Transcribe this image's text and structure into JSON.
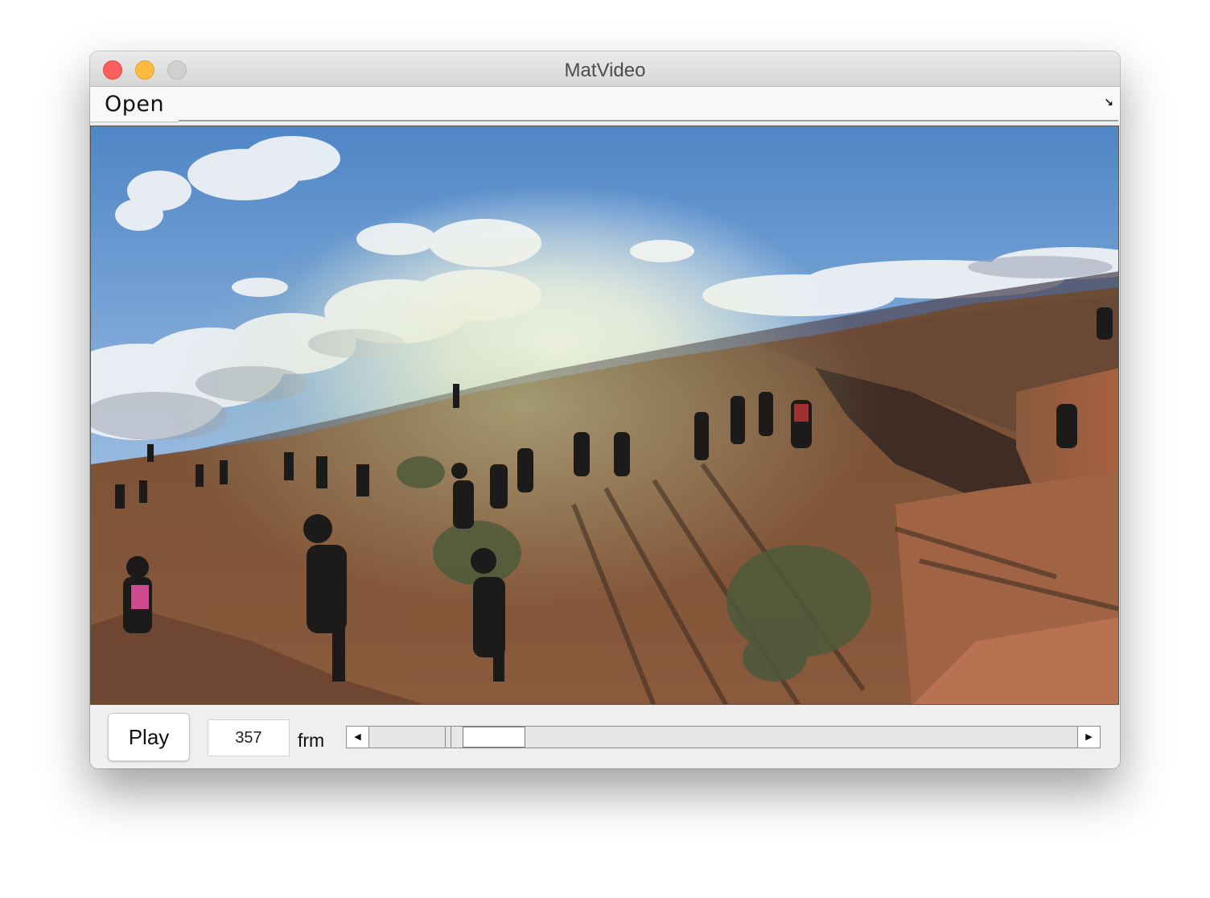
{
  "window": {
    "title": "MatVideo"
  },
  "menubar": {
    "items": [
      {
        "label": "Open"
      }
    ],
    "toolbar_toggle_icon": "expand-arrow-icon"
  },
  "video": {
    "description_icon": "video-frame"
  },
  "controls": {
    "play_label": "Play",
    "frame_value": "357",
    "frame_unit": "frm",
    "slider_position": 0.145,
    "slider_left_icon": "arrow-left-icon",
    "slider_right_icon": "arrow-right-icon"
  },
  "colors": {
    "close": "#fc605c",
    "minimize": "#fdbc40",
    "zoom": "#d0d0d0"
  }
}
